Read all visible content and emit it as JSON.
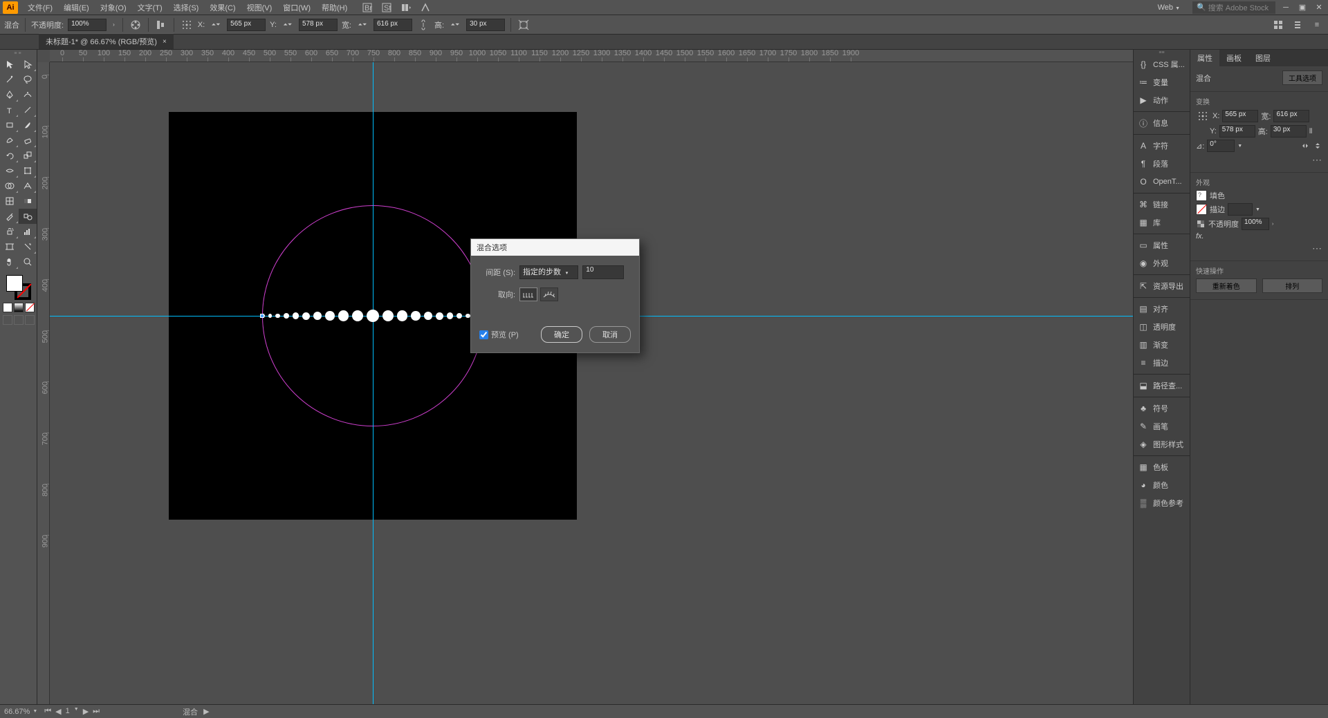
{
  "app": {
    "icon_label": "Ai"
  },
  "menu": {
    "items": [
      "文件(F)",
      "编辑(E)",
      "对象(O)",
      "文字(T)",
      "选择(S)",
      "效果(C)",
      "视图(V)",
      "窗口(W)",
      "帮助(H)"
    ],
    "workspace": "Web",
    "search_placeholder": "搜索 Adobe Stock"
  },
  "control": {
    "tool_label": "混合",
    "opacity_label": "不透明度:",
    "opacity_value": "100%",
    "x_label": "X:",
    "x_value": "565 px",
    "y_label": "Y:",
    "y_value": "578 px",
    "w_label": "宽:",
    "w_value": "616 px",
    "h_label": "高:",
    "h_value": "30 px"
  },
  "doc_tab": {
    "title": "未标题-1* @ 66.67% (RGB/预览)"
  },
  "ruler": {
    "h_marks": [
      0,
      50,
      100,
      150,
      200,
      250,
      300,
      350,
      400,
      450,
      500,
      550,
      600,
      650,
      700,
      750,
      800,
      850,
      900,
      950,
      1000,
      1050,
      1100,
      1150,
      1200,
      1250,
      1300,
      1350,
      1400,
      1450,
      1500,
      1550,
      1600,
      1650,
      1700,
      1750,
      1800,
      1850,
      1900
    ],
    "v_marks": [
      0,
      100,
      200,
      300,
      400,
      500,
      600,
      700,
      800,
      900
    ]
  },
  "panels": {
    "items": [
      {
        "icon": "css",
        "label": "CSS 属..."
      },
      {
        "icon": "var",
        "label": "变量"
      },
      {
        "icon": "play",
        "label": "动作"
      },
      {
        "sep": true
      },
      {
        "icon": "info",
        "label": "信息"
      },
      {
        "sep": true
      },
      {
        "icon": "A",
        "label": "字符"
      },
      {
        "icon": "para",
        "label": "段落"
      },
      {
        "icon": "O",
        "label": "OpenT..."
      },
      {
        "sep": true
      },
      {
        "icon": "link",
        "label": "链接"
      },
      {
        "icon": "lib",
        "label": "库"
      },
      {
        "sep": true
      },
      {
        "icon": "prop",
        "label": "属性"
      },
      {
        "icon": "eye",
        "label": "外观"
      },
      {
        "sep": true
      },
      {
        "icon": "export",
        "label": "资源导出"
      },
      {
        "sep": true
      },
      {
        "icon": "align",
        "label": "对齐"
      },
      {
        "icon": "trans",
        "label": "透明度"
      },
      {
        "icon": "grad",
        "label": "渐变"
      },
      {
        "icon": "stroke",
        "label": "描边"
      },
      {
        "sep": true
      },
      {
        "icon": "path",
        "label": "路径查..."
      },
      {
        "sep": true
      },
      {
        "icon": "symbol",
        "label": "符号"
      },
      {
        "icon": "brush",
        "label": "画笔"
      },
      {
        "icon": "graphic",
        "label": "图形样式"
      },
      {
        "sep": true
      },
      {
        "icon": "swatches",
        "label": "色板"
      },
      {
        "icon": "color",
        "label": "颜色"
      },
      {
        "icon": "guide",
        "label": "颜色参考"
      }
    ]
  },
  "props": {
    "tabs": [
      "属性",
      "画板",
      "图层"
    ],
    "selection_label": "混合",
    "tool_options_btn": "工具选项",
    "transform_title": "变换",
    "x_label": "X:",
    "x_value": "565 px",
    "y_label": "Y:",
    "y_value": "578 px",
    "w_label": "宽:",
    "w_value": "616 px",
    "h_label": "高:",
    "h_value": "30 px",
    "angle_label": "⊿:",
    "angle_value": "0°",
    "appearance_title": "外观",
    "fill_label": "填色",
    "stroke_label": "描边",
    "opacity_label": "不透明度",
    "opacity_value": "100%",
    "fx_label": "fx.",
    "quick_title": "快速操作",
    "recolor_btn": "重新着色",
    "arrange_btn": "排列"
  },
  "status": {
    "zoom": "66.67%",
    "artboard": "1",
    "tool": "混合"
  },
  "dialog": {
    "title": "混合选项",
    "spacing_label": "间距 (S):",
    "spacing_method": "指定的步数",
    "spacing_value": "10",
    "orient_label": "取向:",
    "preview_label": "预览 (P)",
    "ok": "确定",
    "cancel": "取消"
  }
}
